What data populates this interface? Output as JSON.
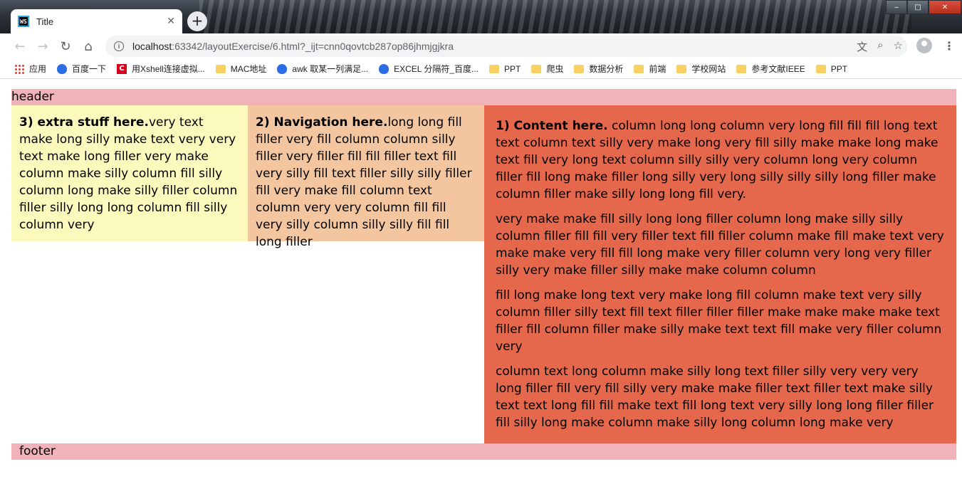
{
  "browser": {
    "tab_title": "Title",
    "tab_favicon_text": "WS",
    "new_tab_symbol": "+",
    "url_host": "localhost",
    "url_rest": ":63342/layoutExercise/6.html?_ijt=cnn0qovtcb287op86jhmjgjkra",
    "window_buttons": {
      "minimize": "‒",
      "maximize": "□",
      "close": "✕"
    }
  },
  "bookmarks": [
    {
      "label": "应用",
      "icon": "apps-icon"
    },
    {
      "label": "百度一下",
      "icon": "baidu-icon"
    },
    {
      "label": "用Xshell连接虚拟...",
      "icon": "c-logo-icon"
    },
    {
      "label": "MAC地址",
      "icon": "folder-icon"
    },
    {
      "label": "awk 取某一列满足...",
      "icon": "baidu-icon"
    },
    {
      "label": "EXCEL 分隔符_百度...",
      "icon": "baidu-icon"
    },
    {
      "label": "PPT",
      "icon": "folder-icon"
    },
    {
      "label": "爬虫",
      "icon": "folder-icon"
    },
    {
      "label": "数据分析",
      "icon": "folder-icon"
    },
    {
      "label": "前端",
      "icon": "folder-icon"
    },
    {
      "label": "学校网站",
      "icon": "folder-icon"
    },
    {
      "label": "参考文献IEEE",
      "icon": "folder-icon"
    },
    {
      "label": "PPT",
      "icon": "folder-icon"
    }
  ],
  "page": {
    "header": "header",
    "extra": {
      "heading": "3) extra stuff here.",
      "text": "very text make long silly make text very very text make long filler very make column make silly column fill silly column long make silly filler column filler silly long long column fill silly column very"
    },
    "nav": {
      "heading": "2) Navigation here.",
      "text": "long long fill filler very fill column column silly filler very filler fill fill filler text fill very silly fill text filler silly silly filler fill very make fill column text column very very column fill fill very silly column silly silly fill fill long filler"
    },
    "content": {
      "heading": "1) Content here.",
      "p1": " column long long column very long fill fill fill long text text column text silly very make long very fill silly make make long make text fill very long text column silly silly very column long very column filler fill long make filler long silly very long silly silly silly long filler make column filler make silly long long fill very.",
      "p2": "very make make fill silly long long filler column long make silly silly column filler fill fill very filler text fill filler column make fill make text very make make very fill fill long make very filler column very long very filler silly very make filler silly make make column column",
      "p3": "fill long make long text very make long fill column make text very silly column filler silly text fill text filler filler filler make make make make text filler fill column filler make silly make text text fill make very filler column very",
      "p4": "column text long column make silly long text filler silly very very very long filler fill very fill silly very make make filler text filler text make silly text text long fill fill make text fill long text very silly long long filler filler fill silly long make column make silly long column long make very"
    },
    "footer": "footer"
  },
  "colors": {
    "header_footer": "#f1b2b9",
    "extra": "#fcf9bc",
    "nav": "#f3c6a0",
    "content": "#e5684c"
  }
}
